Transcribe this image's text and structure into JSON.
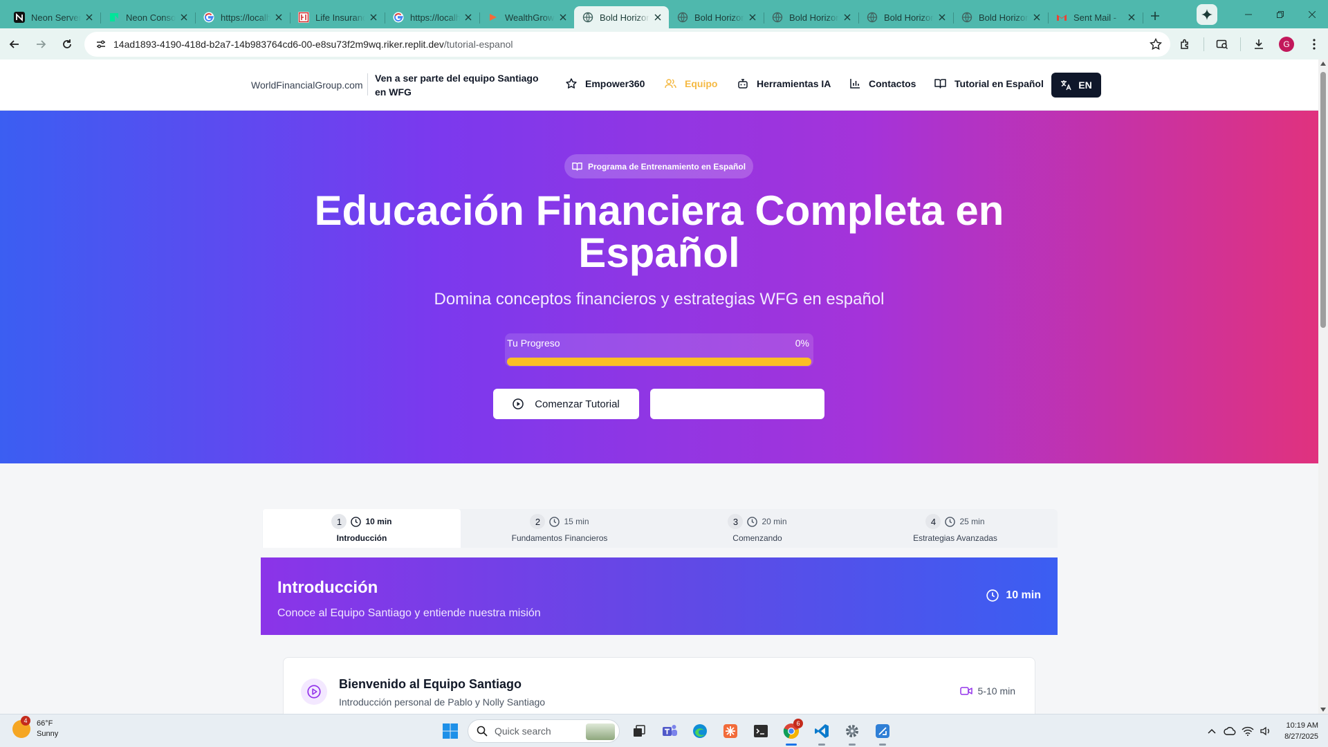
{
  "browser": {
    "tabs": [
      {
        "title": "Neon Serverless",
        "favicon": "neon-n-icon",
        "active": false
      },
      {
        "title": "Neon Console",
        "favicon": "neon-logo-icon",
        "active": false
      },
      {
        "title": "https://localhost",
        "favicon": "google-g-icon",
        "active": false
      },
      {
        "title": "Life Insurance",
        "favicon": "red-square-icon",
        "active": false
      },
      {
        "title": "https://localhost",
        "favicon": "google-g-icon",
        "active": false
      },
      {
        "title": "WealthGrow",
        "favicon": "orange-play-icon",
        "active": false
      },
      {
        "title": "Bold Horizon",
        "favicon": "globe-icon",
        "active": true
      },
      {
        "title": "Bold Horizon",
        "favicon": "globe-icon",
        "active": false
      },
      {
        "title": "Bold Horizon",
        "favicon": "globe-icon",
        "active": false
      },
      {
        "title": "Bold Horizon",
        "favicon": "globe-icon",
        "active": false
      },
      {
        "title": "Bold Horizon",
        "favicon": "globe-icon",
        "active": false
      },
      {
        "title": "Sent Mail - ",
        "favicon": "gmail-icon",
        "active": false
      }
    ],
    "url_host": "14ad1893-4190-418d-b2a7-14b983764cd6-00-e8su73f2m9wq.riker.replit.dev",
    "url_path": "/tutorial-espanol",
    "profile_initial": "G",
    "theme_color": "#4fb8ad"
  },
  "nav": {
    "site": "WorldFinancialGroup.com",
    "tagline": "Ven a ser parte del equipo Santiago en WFG",
    "items": [
      {
        "label": "Empower360",
        "icon": "star-icon",
        "active": false
      },
      {
        "label": "Equipo",
        "icon": "users-icon",
        "active": true
      },
      {
        "label": "Herramientas IA",
        "icon": "bot-icon",
        "active": false
      },
      {
        "label": "Contactos",
        "icon": "bar-chart-icon",
        "active": false
      },
      {
        "label": "Tutorial en Español",
        "icon": "book-open-icon",
        "active": false
      }
    ],
    "lang_label": "EN",
    "active_color": "#f5b942"
  },
  "hero": {
    "badge": "Programa de Entrenamiento en Español",
    "title": "Educación Financiera Completa en Español",
    "subtitle": "Domina conceptos financieros y estrategias WFG en español",
    "progress_label": "Tu Progreso",
    "progress_value": "0%",
    "start_button": "Comenzar Tutorial",
    "secondary_button": "",
    "gradient": [
      "#3b5ef2",
      "#7b39ee",
      "#a533d9",
      "#e0327e"
    ]
  },
  "steps": [
    {
      "num": "1",
      "duration": "10 min",
      "name": "Introducción",
      "active": true
    },
    {
      "num": "2",
      "duration": "15 min",
      "name": "Fundamentos Financieros",
      "active": false
    },
    {
      "num": "3",
      "duration": "20 min",
      "name": "Comenzando",
      "active": false
    },
    {
      "num": "4",
      "duration": "25 min",
      "name": "Estrategias Avanzadas",
      "active": false
    }
  ],
  "section": {
    "title": "Introducción",
    "description": "Conoce al Equipo Santiago y entiende nuestra misión",
    "duration": "10 min"
  },
  "lesson": {
    "title": "Bienvenido al Equipo Santiago",
    "description": "Introducción personal de Pablo y Nolly Santiago",
    "meta": "5-10 min",
    "icon": "play-circle-icon",
    "meta_icon": "video-icon"
  },
  "taskbar": {
    "weather_temp": "66°F",
    "weather_desc": "Sunny",
    "weather_badge": "4",
    "search_placeholder": "Quick search",
    "chrome_badge": "6",
    "time": "10:19 AM",
    "date": "8/27/2025"
  }
}
